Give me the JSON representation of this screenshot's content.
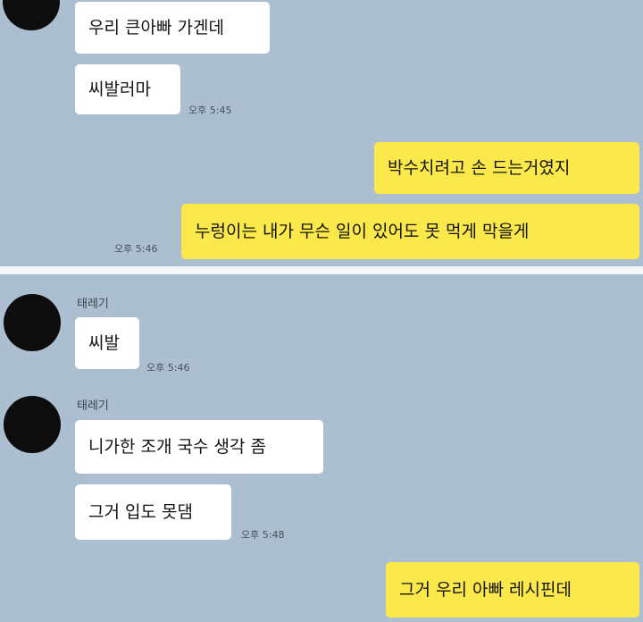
{
  "colors": {
    "chat_background": "#abbfd0",
    "incoming_bubble": "#ffffff",
    "outgoing_bubble": "#fbe84a",
    "avatar": "#0d0d0d"
  },
  "top": {
    "messages": [
      {
        "text": "우리 큰아빠 가겐데"
      },
      {
        "text": "씨발러마",
        "time": "오후 5:45"
      },
      {
        "text": "박수치려고 손 드는거였지"
      },
      {
        "text": "누렁이는 내가 무슨 일이 있어도 못 먹게 막을게",
        "time": "오후 5:46"
      }
    ]
  },
  "bottom": {
    "group1": {
      "sender": "태레기",
      "messages": [
        {
          "text": "씨발",
          "time": "오후 5:46"
        }
      ]
    },
    "group2": {
      "sender": "태레기",
      "messages": [
        {
          "text": "니가한 조개 국수 생각 좀"
        },
        {
          "text": "그거 입도 못댐",
          "time": "오후 5:48"
        }
      ]
    },
    "reply": {
      "text": "그거 우리 아빠 레시핀데"
    }
  }
}
